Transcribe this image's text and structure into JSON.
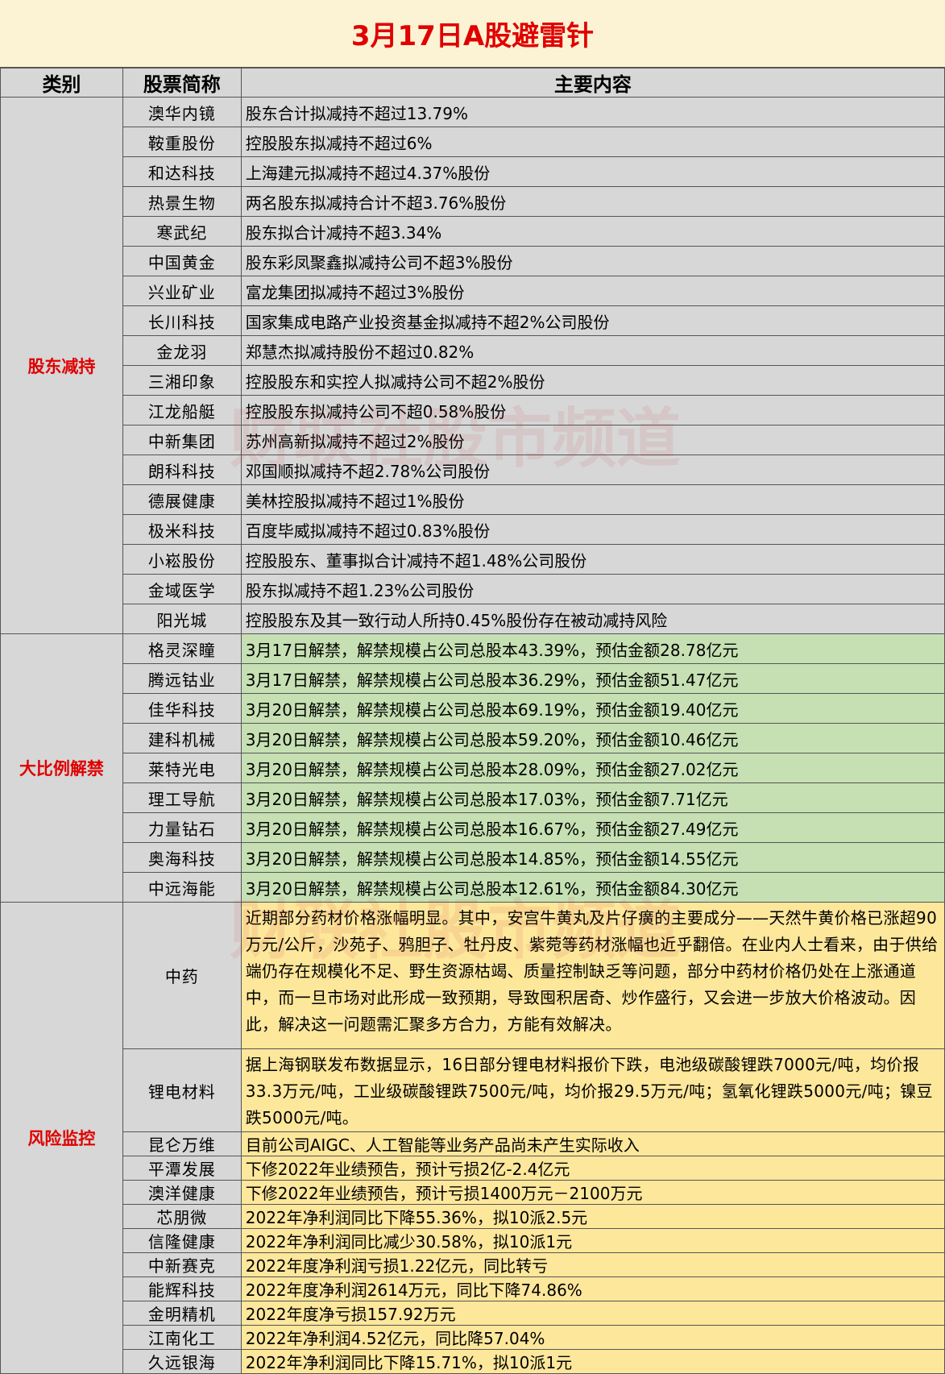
{
  "title": "3月17日A股避雷针",
  "headers": {
    "category": "类别",
    "stock": "股票简称",
    "content": "主要内容"
  },
  "watermark": "财联社股市频道",
  "sections": [
    {
      "category": "股东减持",
      "style": "grey",
      "rows": [
        {
          "name": "澳华内镜",
          "content": "股东合计拟减持不超过13.79%"
        },
        {
          "name": "鞍重股份",
          "content": "控股股东拟减持不超过6%"
        },
        {
          "name": "和达科技",
          "content": "上海建元拟减持不超过4.37%股份"
        },
        {
          "name": "热景生物",
          "content": "两名股东拟减持合计不超3.76%股份"
        },
        {
          "name": "寒武纪",
          "content": "股东拟合计减持不超3.34%"
        },
        {
          "name": "中国黄金",
          "content": "股东彩凤聚鑫拟减持公司不超3%股份"
        },
        {
          "name": "兴业矿业",
          "content": "富龙集团拟减持不超过3%股份"
        },
        {
          "name": "长川科技",
          "content": "国家集成电路产业投资基金拟减持不超2%公司股份"
        },
        {
          "name": "金龙羽",
          "content": "郑慧杰拟减持股份不超过0.82%"
        },
        {
          "name": "三湘印象",
          "content": "控股股东和实控人拟减持公司不超2%股份"
        },
        {
          "name": "江龙船艇",
          "content": "控股股东拟减持公司不超0.58%股份"
        },
        {
          "name": "中新集团",
          "content": "苏州高新拟减持不超过2%股份"
        },
        {
          "name": "朗科科技",
          "content": "邓国顺拟减持不超2.78%公司股份"
        },
        {
          "name": "德展健康",
          "content": "美林控股拟减持不超过1%股份"
        },
        {
          "name": "极米科技",
          "content": "百度毕威拟减持不超过0.83%股份"
        },
        {
          "name": "小崧股份",
          "content": "控股股东、董事拟合计减持不超1.48%公司股份"
        },
        {
          "name": "金域医学",
          "content": "股东拟减持不超1.23%公司股份"
        },
        {
          "name": "阳光城",
          "content": "控股股东及其一致行动人所持0.45%股份存在被动减持风险"
        }
      ]
    },
    {
      "category": "大比例解禁",
      "style": "green",
      "rows": [
        {
          "name": "格灵深瞳",
          "content": "3月17日解禁，解禁规模占公司总股本43.39%，预估金额28.78亿元"
        },
        {
          "name": "腾远钴业",
          "content": "3月17日解禁，解禁规模占公司总股本36.29%，预估金额51.47亿元"
        },
        {
          "name": "佳华科技",
          "content": "3月20日解禁，解禁规模占公司总股本69.19%，预估金额19.40亿元"
        },
        {
          "name": "建科机械",
          "content": "3月20日解禁，解禁规模占公司总股本59.20%，预估金额10.46亿元"
        },
        {
          "name": "莱特光电",
          "content": "3月20日解禁，解禁规模占公司总股本28.09%，预估金额27.02亿元"
        },
        {
          "name": "理工导航",
          "content": "3月20日解禁，解禁规模占公司总股本17.03%，预估金额7.71亿元"
        },
        {
          "name": "力量钻石",
          "content": "3月20日解禁，解禁规模占公司总股本16.67%，预估金额27.49亿元"
        },
        {
          "name": "奥海科技",
          "content": "3月20日解禁，解禁规模占公司总股本14.85%，预估金额14.55亿元"
        },
        {
          "name": "中远海能",
          "content": "3月20日解禁，解禁规模占公司总股本12.61%，预估金额84.30亿元"
        }
      ]
    },
    {
      "category": "风险监控",
      "style": "yellow",
      "rows": [
        {
          "name": "中药",
          "content": "近期部分药材价格涨幅明显。其中，安宫牛黄丸及片仔癀的主要成分——天然牛黄价格已涨超90万元/公斤，沙苑子、鸦胆子、牡丹皮、紫菀等药材涨幅也近乎翻倍。在业内人士看来，由于供给端仍存在规模化不足、野生资源枯竭、质量控制缺乏等问题，部分中药材价格仍处在上涨通道中，而一旦市场对此形成一致预期，导致囤积居奇、炒作盛行，又会进一步放大价格波动。因此，解决这一问题需汇聚多方合力，方能有效解决。"
        },
        {
          "name": "锂电材料",
          "content": "据上海钢联发布数据显示，16日部分锂电材料报价下跌，电池级碳酸锂跌7000元/吨，均价报33.3万元/吨，工业级碳酸锂跌7500元/吨，均价报29.5万元/吨；氢氧化锂跌5000元/吨；镍豆跌5000元/吨。"
        },
        {
          "name": "昆仑万维",
          "content": "目前公司AIGC、人工智能等业务产品尚未产生实际收入"
        },
        {
          "name": "平潭发展",
          "content": "下修2022年业绩预告，预计亏损2亿-2.4亿元"
        },
        {
          "name": "澳洋健康",
          "content": "下修2022年业绩预告，预计亏损1400万元－2100万元"
        },
        {
          "name": "芯朋微",
          "content": "2022年净利润同比下降55.36%，拟10派2.5元"
        },
        {
          "name": "信隆健康",
          "content": "2022年净利润同比减少30.58%，拟10派1元"
        },
        {
          "name": "中新赛克",
          "content": "2022年度净利润亏损1.22亿元，同比转亏"
        },
        {
          "name": "能辉科技",
          "content": "2022年度净利润2614万元，同比下降74.86%"
        },
        {
          "name": "金明精机",
          "content": "2022年度净亏损157.92万元"
        },
        {
          "name": "江南化工",
          "content": "2022年净利润4.52亿元，同比降57.04%"
        },
        {
          "name": "久远银海",
          "content": "2022年净利润同比下降15.71%，拟10派1元"
        }
      ]
    }
  ]
}
